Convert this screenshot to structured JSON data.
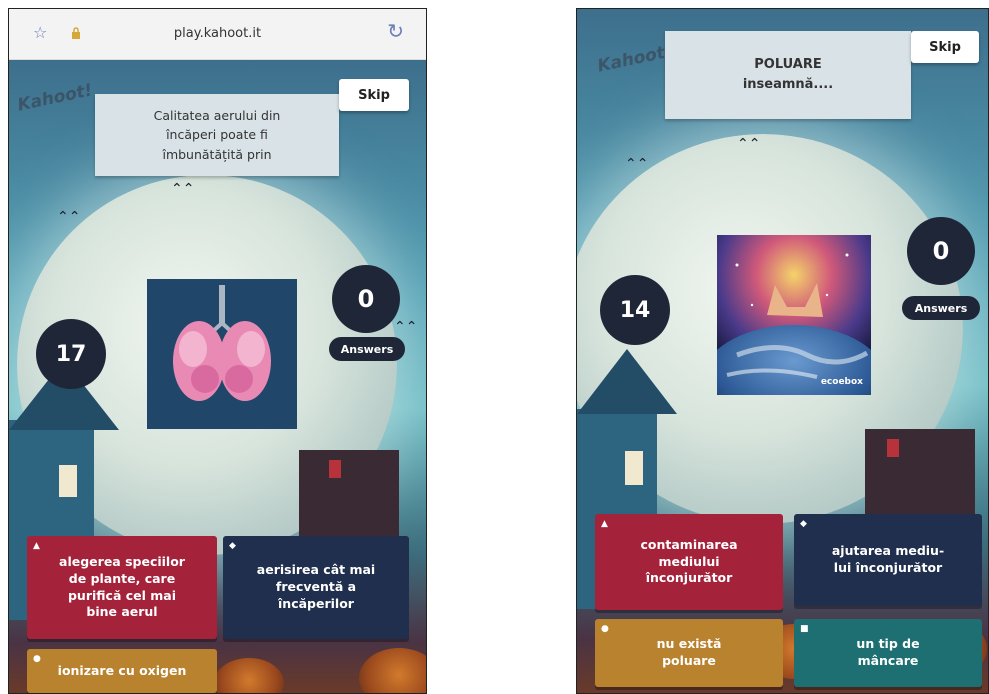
{
  "left_screen": {
    "browser": {
      "url": "play.kahoot.it",
      "star_icon": "☆",
      "lock_icon": "🔒",
      "reload_icon": "↻"
    },
    "logo": "Kahoot!",
    "question": "Calitatea aerului din\nîncăperi poate fi\nîmbunătățită prin",
    "skip": "Skip",
    "timer": "17",
    "answer_count": "0",
    "answers_label": "Answers",
    "answers": [
      {
        "shape": "▲",
        "text": "alegerea speciilor\nde plante, care\npurifică cel mai\nbine aerul",
        "color": "#a4223a"
      },
      {
        "shape": "◆",
        "text": "aerisirea cât mai\nfrecventă a\nîncăperilor",
        "color": "#1f2f4d"
      },
      {
        "shape": "●",
        "text": "ionizare cu oxigen",
        "color": "#b8822f"
      }
    ]
  },
  "right_screen": {
    "logo": "Kahoot!",
    "question": "POLUARE\ninseamnă....",
    "skip": "Skip",
    "timer": "14",
    "answer_count": "0",
    "answers_label": "Answers",
    "media_watermark": "ecoebox",
    "answers": [
      {
        "shape": "▲",
        "text": "contaminarea\nmediului\nînconjurător",
        "color": "#a4223a"
      },
      {
        "shape": "◆",
        "text": "ajutarea mediu-\nlui înconjurător",
        "color": "#1f2f4d"
      },
      {
        "shape": "●",
        "text": "nu există\npoluare",
        "color": "#b8822f"
      },
      {
        "shape": "■",
        "text": "un tip de\nmâncare",
        "color": "#1e6f72"
      }
    ]
  }
}
